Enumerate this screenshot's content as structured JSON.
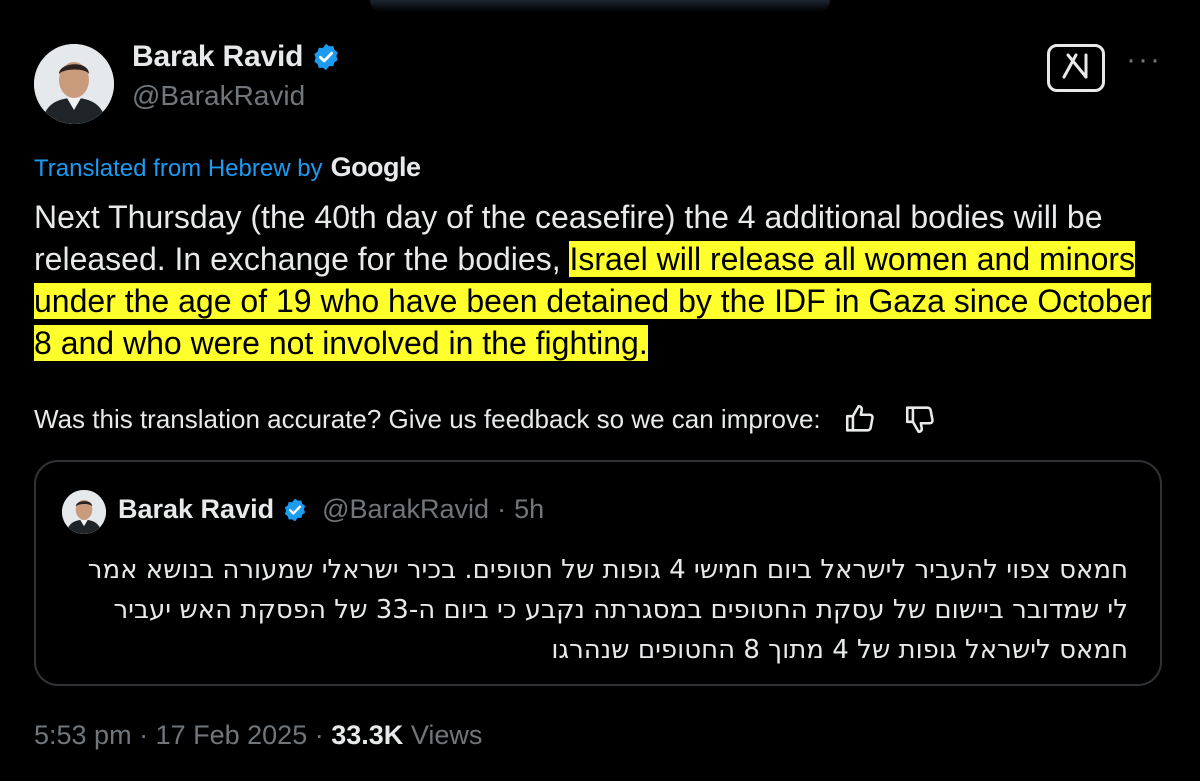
{
  "author": {
    "name": "Barak Ravid",
    "handle": "@BarakRavid"
  },
  "translation": {
    "label": "Translated from Hebrew by",
    "provider": "Google"
  },
  "tweet": {
    "text_plain": "Next Thursday (the 40th day of the ceasefire) the 4 additional bodies will be released. In exchange for the bodies, ",
    "text_highlighted": "Israel will release all women and minors under the age of 19 who have been detained by the IDF in Gaza since October 8 and who were not involved in the fighting."
  },
  "feedback": {
    "prompt": "Was this translation accurate? Give us feedback so we can improve:"
  },
  "quoted_tweet": {
    "name": "Barak Ravid",
    "handle": "@BarakRavid",
    "separator": "·",
    "time": "5h",
    "text": "חמאס צפוי להעביר לישראל ביום חמישי 4 גופות של חטופים. בכיר ישראלי שמעורה בנושא אמר לי שמדובר ביישום של עסקת החטופים במסגרתה נקבע כי ביום ה-33 של הפסקת האש יעביר חמאס לישראל גופות של 4 מתוך 8 החטופים שנהרגו"
  },
  "meta": {
    "time": "5:53 pm",
    "dot1": "·",
    "date": "17 Feb 2025",
    "dot2": "·",
    "views_count": "33.3K",
    "views_label": "Views"
  },
  "icons": [
    "verified-badge-icon",
    "grok-icon",
    "more-icon",
    "thumbs-up-icon",
    "thumbs-down-icon"
  ],
  "colors": {
    "background": "#000000",
    "text": "#e7e9ea",
    "secondary": "#71767b",
    "link": "#1d9bf0",
    "highlight": "#ffff2b",
    "verified": "#1d9bf0",
    "border": "#2f3336"
  }
}
